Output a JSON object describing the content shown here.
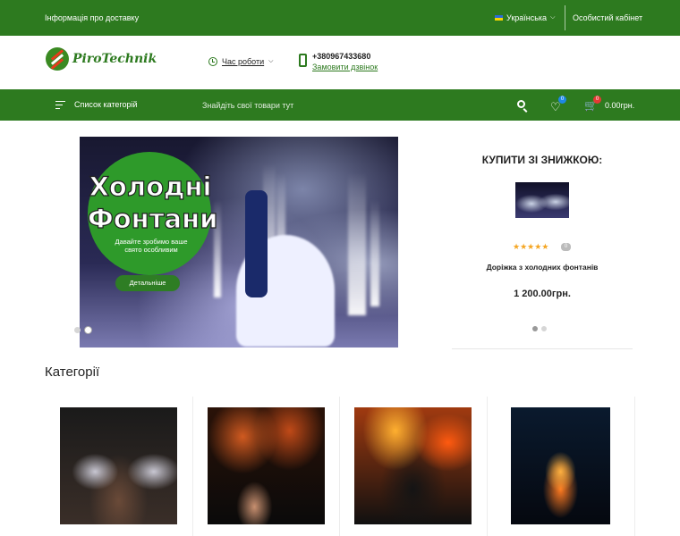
{
  "topbar": {
    "delivery_info": "Інформація про доставку",
    "language": "Українська",
    "cabinet": "Особистий кабінет"
  },
  "header": {
    "logo_text": "PiroTechnik",
    "hours_label": "Час роботи",
    "phone": "+380967433680",
    "callback": "Замовити дзвінок"
  },
  "nav": {
    "categories_label": "Список категорій",
    "search_placeholder": "Знайдіть свої товари тут",
    "wishlist_count": "0",
    "cart_count": "0",
    "cart_total": "0.00грн."
  },
  "banner": {
    "title": "Холодні Фонтани",
    "subtitle": "Давайте зробимо ваше свято особливим",
    "button": "Детальніше",
    "active_slide": 2
  },
  "sale": {
    "title": "КУПИТИ ЗІ ЗНИЖКОЮ:",
    "rating": 5,
    "reviews": "0",
    "product_name": "Доріжка з холодних фонтанів",
    "price": "1 200.00грн.",
    "active_slide": 1
  },
  "categories": {
    "title": "Категорії"
  },
  "colors": {
    "brand_green": "#2d7a1f",
    "star": "#f5a623",
    "badge_blue": "#1e88e5",
    "badge_red": "#e53935"
  }
}
